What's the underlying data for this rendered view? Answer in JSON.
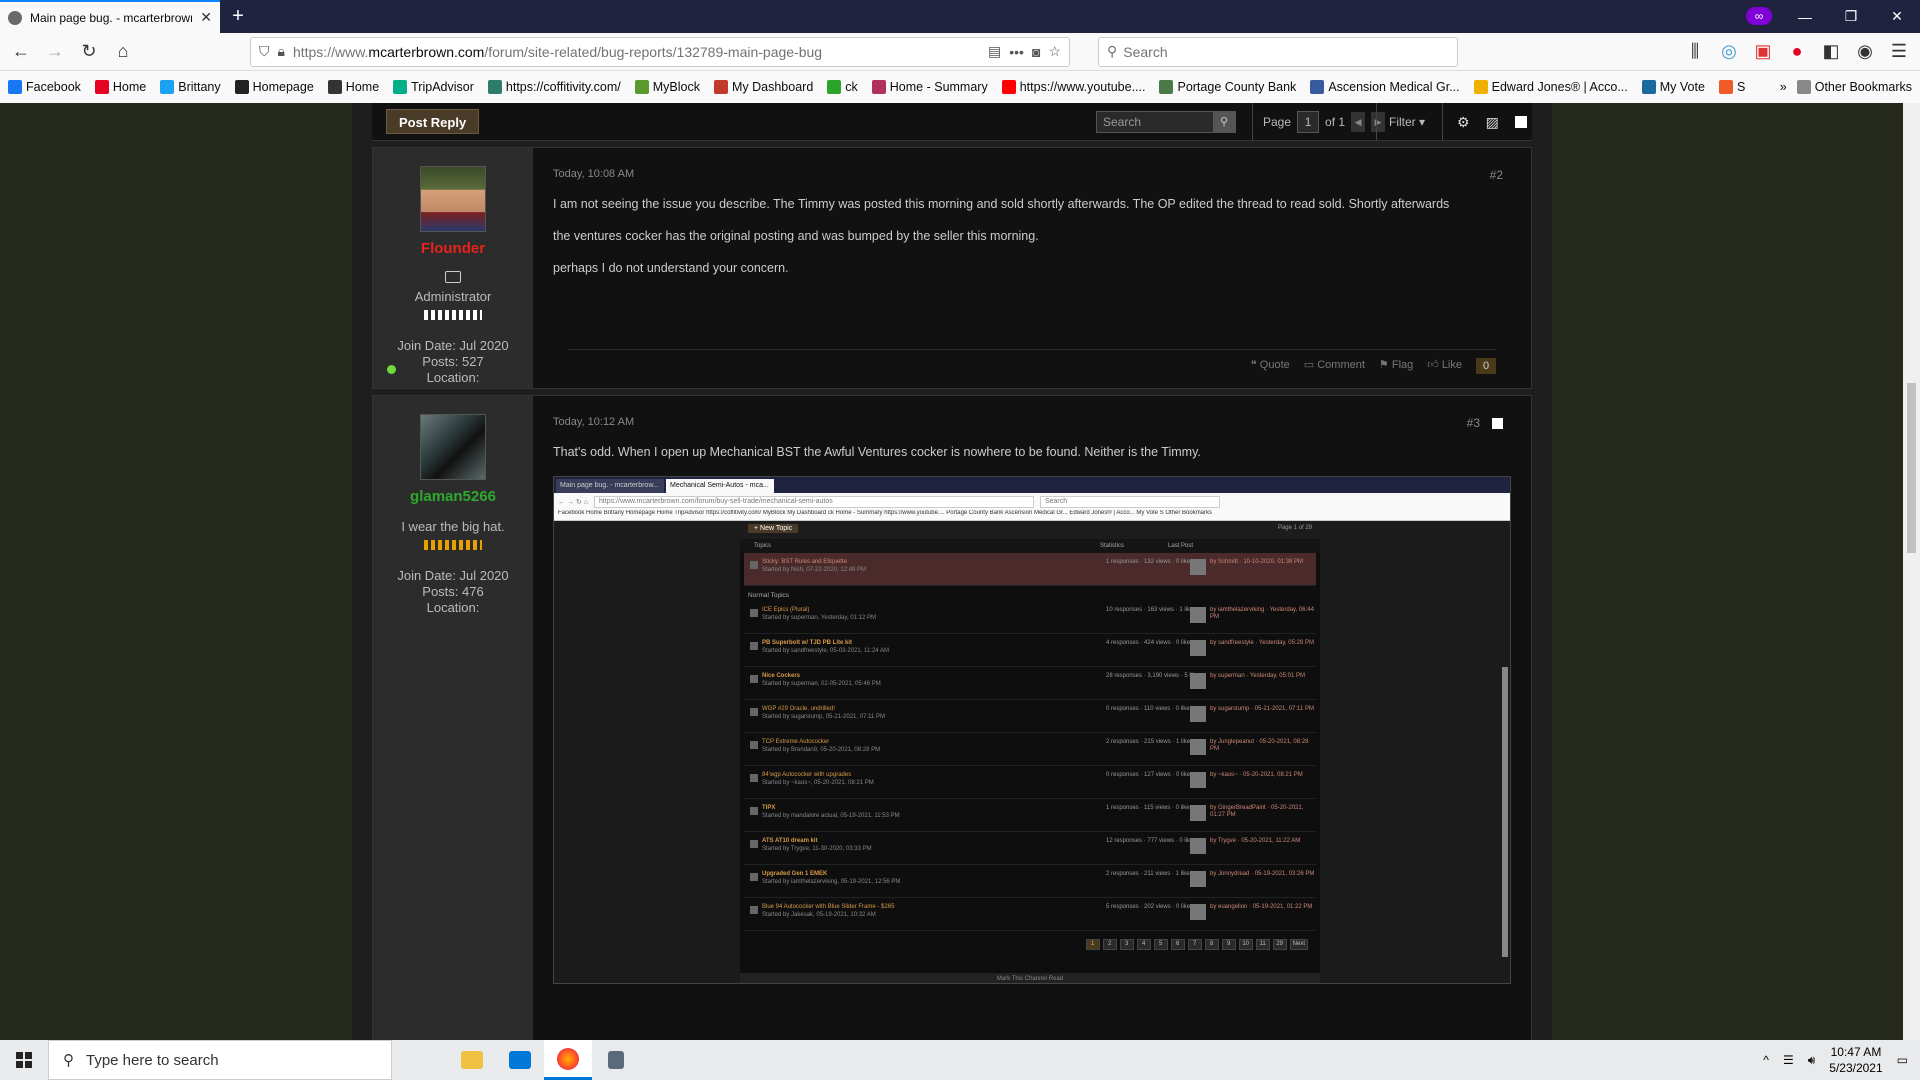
{
  "browser": {
    "tab_title": "Main page bug. - mcarterbrown.com",
    "tab_close": "✕",
    "new_tab": "+",
    "window_min": "—",
    "window_max": "❐",
    "window_close": "✕",
    "private_badge": "∞",
    "back": "←",
    "forward": "→",
    "reload": "↻",
    "home": "⌂",
    "url_scheme": "https://www.",
    "url_host": "mcarterbrown.com",
    "url_path": "/forum/site-related/bug-reports/132789-main-page-bug",
    "search_placeholder": "Search",
    "menu_dots": "•••",
    "menu": "☰",
    "bookmarks": [
      {
        "label": "Facebook",
        "color": "#1877f2"
      },
      {
        "label": "Home",
        "color": "#e60023"
      },
      {
        "label": "Brittany",
        "color": "#1da1f2"
      },
      {
        "label": "Homepage",
        "color": "#222222"
      },
      {
        "label": "Home",
        "color": "#333333"
      },
      {
        "label": "TripAdvisor",
        "color": "#00af87"
      },
      {
        "label": "https://coffitivity.com/",
        "color": "#2e7d6b"
      },
      {
        "label": "MyBlock",
        "color": "#5a9a2a"
      },
      {
        "label": "My Dashboard",
        "color": "#c0392b"
      },
      {
        "label": "ck",
        "color": "#2aa52a"
      },
      {
        "label": "Home - Summary",
        "color": "#b0325a"
      },
      {
        "label": "https://www.youtube....",
        "color": "#ff0000"
      },
      {
        "label": "Portage County Bank",
        "color": "#4a7a4a"
      },
      {
        "label": "Ascension Medical Gr...",
        "color": "#3a5aa0"
      },
      {
        "label": "Edward Jones® | Acco...",
        "color": "#f0b000"
      },
      {
        "label": "My Vote",
        "color": "#1a6aa0"
      },
      {
        "label": "S",
        "color": "#f05a28"
      }
    ],
    "bookmarks_more": "»",
    "other_bookmarks": "Other Bookmarks"
  },
  "toolbar": {
    "post_reply": "Post Reply",
    "search_placeholder": "Search",
    "page_label": "Page",
    "page_current": "1",
    "page_of": "of 1",
    "filter": "Filter"
  },
  "posts": [
    {
      "number": "#2",
      "date": "Today, 10:08 AM",
      "author": "Flounder",
      "author_color": "#e8231b",
      "role": "Administrator",
      "join_date": "Join Date: Jul 2020",
      "posts": "Posts: 527",
      "location": "Location:",
      "paragraphs": [
        "I am not seeing the issue you describe. The Timmy was posted this morning and sold shortly afterwards. The OP edited the thread to read sold. Shortly afterwards",
        "the ventures cocker has the original posting and was bumped by the seller this morning.",
        "perhaps I do not understand your concern."
      ],
      "actions": {
        "quote": "Quote",
        "comment": "Comment",
        "flag": "Flag",
        "like": "Like",
        "like_count": "0"
      }
    },
    {
      "number": "#3",
      "date": "Today, 10:12 AM",
      "author": "glaman5266",
      "author_color": "#2fa82f",
      "role": "I wear the big hat.",
      "join_date": "Join Date: Jul 2020",
      "posts": "Posts: 476",
      "location": "Location:",
      "paragraphs": [
        "That's odd. When I open up Mechanical BST the Awful Ventures cocker is nowhere to be found. Neither is the Timmy."
      ]
    }
  ],
  "embedded": {
    "tab1": "Main page bug. - mcarterbrow...",
    "tab2": "Mechanical Semi-Autos - mca...",
    "url": "https://www.mcarterbrown.com/forum/buy-sell-trade/mechanical-semi-autos",
    "search": "Search",
    "bookmarks": "Facebook  Home  Brittany  Homepage  Home  TripAdvisor  https://coffitivity.com/  MyBlock  My Dashboard  ck  Home - Summary  https://www.youtube....  Portage County Bank  Ascension Medical Gr...  Edward Jones® | Acco...  My Vote  S  Other Bookmarks",
    "new_topic": "+ New Topic",
    "page_info": "Page 1 of 29",
    "col_topics": "Topics",
    "col_stats": "Statistics",
    "col_last": "Last Post",
    "sticky_title": "Sticky: BST Rules and Etiquette",
    "sticky_sub": "Started by Nish, 07-22-2020, 12:49 PM",
    "sticky_stats": "1 responses · 132 views · 0 likes",
    "sticky_last": "by Schmitt · 10-10-2020, 01:38 PM",
    "section": "Normal Topics",
    "rows": [
      {
        "title": "ICE Epics (Plural)",
        "sub": "Started by superman, Yesterday, 01:12 PM",
        "stats": "10 responses · 163 views · 1 like",
        "last": "by iamthelazerviking · Yesterday, 06:44 PM"
      },
      {
        "title": "PB Superbolt w/ TJD PB Lite kit",
        "sub": "Started by sandfreestyle, 05-03-2021, 11:24 AM",
        "stats": "4 responses · 424 views · 0 likes",
        "last": "by sandfreestyle · Yesterday, 05:28 PM"
      },
      {
        "title": "Nice Cockers",
        "sub": "Started by superman, 02-05-2021, 05:46 PM",
        "stats": "28 responses · 3,190 views · 5 likes",
        "last": "by superman · Yesterday, 05:01 PM"
      },
      {
        "title": "WGP #29 Oracle, undrilled!",
        "sub": "Started by sugarstump, 05-21-2021, 07:11 PM",
        "stats": "0 responses · 110 views · 0 likes",
        "last": "by sugarstump · 05-21-2021, 07:11 PM"
      },
      {
        "title": "TCP Extreme Autococker",
        "sub": "Started by Brendan9, 05-20-2021, 08:28 PM",
        "stats": "2 responses · 215 views · 1 like",
        "last": "by Junglepeanut · 05-20-2021, 08:28 PM"
      },
      {
        "title": "84'wgp Autococker with upgrades",
        "sub": "Started by ~kaos~, 05-20-2021, 08:21 PM",
        "stats": "0 responses · 127 views · 0 likes",
        "last": "by ~kaos~ · 05-20-2021, 08:21 PM"
      },
      {
        "title": "TIPX",
        "sub": "Started by mandalore actual, 05-19-2021, 11:53 PM",
        "stats": "1 responses · 115 views · 0 likes",
        "last": "by GingerBreadPaint · 05-20-2021, 01:27 PM"
      },
      {
        "title": "ATS AT10 dream kit",
        "sub": "Started by Trygve, 11-30-2020, 03:33 PM",
        "stats": "12 responses · 777 views · 0 likes",
        "last": "by Trygve · 05-20-2021, 11:22 AM"
      },
      {
        "title": "Upgraded Gen 1 EMEK",
        "sub": "Started by iamthelazerviking, 05-19-2021, 12:56 PM",
        "stats": "2 responses · 211 views · 1 like",
        "last": "by Jonnydread · 05-19-2021, 03:26 PM"
      },
      {
        "title": "Blue 94 Autococker with Blue Slider Frame - $265",
        "sub": "Started by Jakesak, 05-19-2021, 10:32 AM",
        "stats": "5 responses · 202 views · 0 likes",
        "last": "by euangelion · 05-19-2021, 01:22 PM"
      }
    ],
    "pages": [
      "1",
      "2",
      "3",
      "4",
      "5",
      "6",
      "7",
      "8",
      "9",
      "10",
      "11",
      "29",
      "Next"
    ],
    "mark_read": "Mark This Channel Read"
  },
  "taskbar": {
    "search_placeholder": "Type here to search",
    "time": "10:47 AM",
    "date": "5/23/2021"
  }
}
